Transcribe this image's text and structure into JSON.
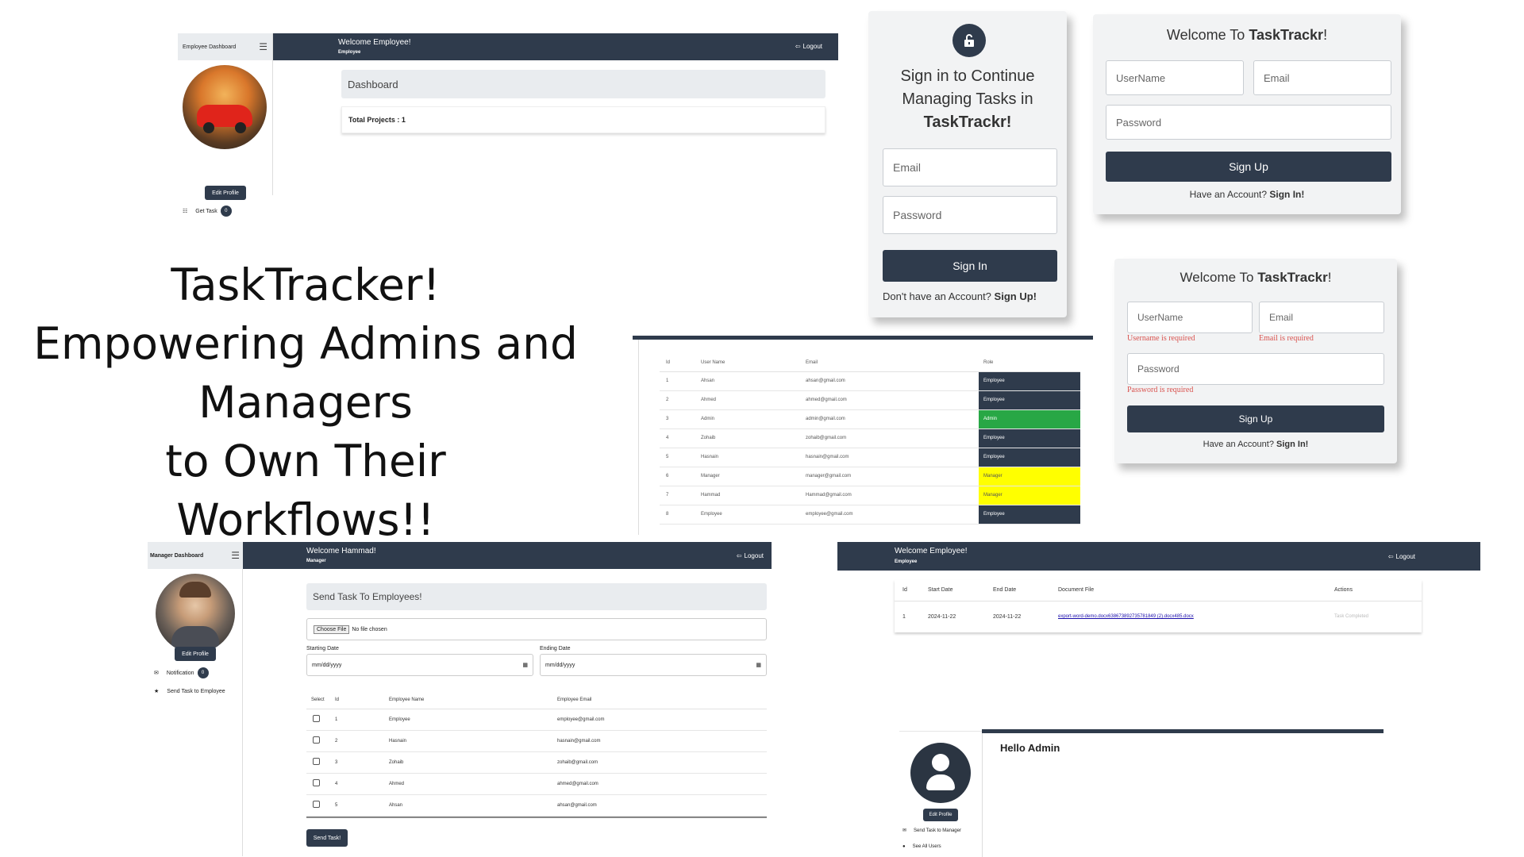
{
  "hero": {
    "line1": "TaskTracker!",
    "line2": "Empowering Admins and",
    "line3": "Managers",
    "line4": "to Own Their Workflows!!"
  },
  "employee_dashboard": {
    "sidebar_title": "Employee Dashboard",
    "welcome": "Welcome Employee!",
    "role": "Employee",
    "logout": "Logout",
    "edit_profile": "Edit Profile",
    "get_task": "Get Task",
    "task_count": "0",
    "dashboard_heading": "Dashboard",
    "total_projects": "Total Projects : 1"
  },
  "signin": {
    "line1": "Sign in to Continue",
    "line2": "Managing Tasks in",
    "brand": "TaskTrackr!",
    "email_placeholder": "Email",
    "password_placeholder": "Password",
    "button": "Sign In",
    "footer_text": "Don't have an Account?",
    "footer_link": "Sign Up!"
  },
  "signup1": {
    "welcome": "Welcome To",
    "brand": "TaskTrackr",
    "excl": "!",
    "username": "UserName",
    "email": "Email",
    "password": "Password",
    "button": "Sign Up",
    "footer_text": "Have an Account?",
    "footer_link": "Sign In!"
  },
  "signup2": {
    "welcome": "Welcome To",
    "brand": "TaskTrackr",
    "excl": "!",
    "username": "UserName",
    "email": "Email",
    "password": "Password",
    "username_error": "Username is required",
    "email_error": "Email is required",
    "password_error": "Password is required",
    "button": "Sign Up",
    "footer_text": "Have an Account?",
    "footer_link": "Sign In!"
  },
  "users_table": {
    "headers": [
      "Id",
      "User Name",
      "Email",
      "Role"
    ],
    "rows": [
      {
        "id": "1",
        "name": "Ahsan",
        "email": "ahsan@gmail.com",
        "role": "Employee",
        "color": "#2f3b4c"
      },
      {
        "id": "2",
        "name": "Ahmed",
        "email": "ahmed@gmail.com",
        "role": "Employee",
        "color": "#2f3b4c"
      },
      {
        "id": "3",
        "name": "Admin",
        "email": "admin@gmail.com",
        "role": "Admin",
        "color": "#28a745"
      },
      {
        "id": "4",
        "name": "Zohaib",
        "email": "zohaib@gmail.com",
        "role": "Employee",
        "color": "#2f3b4c"
      },
      {
        "id": "5",
        "name": "Hasnain",
        "email": "hasnain@gmail.com",
        "role": "Employee",
        "color": "#2f3b4c"
      },
      {
        "id": "6",
        "name": "Manager",
        "email": "manager@gmail.com",
        "role": "Manager",
        "color": "#ffff00"
      },
      {
        "id": "7",
        "name": "Hammad",
        "email": "Hammad@gmail.com",
        "role": "Manager",
        "color": "#ffff00"
      },
      {
        "id": "8",
        "name": "Employee",
        "email": "employee@gmail.com",
        "role": "Employee",
        "color": "#2f3b4c"
      }
    ]
  },
  "manager_dashboard": {
    "sidebar_title": "Manager Dashboard",
    "welcome": "Welcome Hammad!",
    "role": "Manager",
    "logout": "Logout",
    "edit_profile": "Edit Profile",
    "notification": "Notification",
    "notification_count": "0",
    "send_task_employee": "Send Task to Employee",
    "heading": "Send Task To Employees!",
    "choose_file": "Choose File",
    "no_file": "No file chosen",
    "starting_date": "Starting Date",
    "ending_date": "Ending Date",
    "date_placeholder": "mm/dd/yyyy",
    "headers": [
      "Select",
      "Id",
      "Employee Name",
      "Employee Email"
    ],
    "rows": [
      {
        "id": "1",
        "name": "Employee",
        "email": "employee@gmail.com"
      },
      {
        "id": "2",
        "name": "Hasnain",
        "email": "hasnain@gmail.com"
      },
      {
        "id": "3",
        "name": "Zohaib",
        "email": "zohaib@gmail.com"
      },
      {
        "id": "4",
        "name": "Ahmed",
        "email": "ahmed@gmail.com"
      },
      {
        "id": "5",
        "name": "Ahsan",
        "email": "ahsan@gmail.com"
      }
    ],
    "send_button": "Send Task!"
  },
  "employee_tasks": {
    "welcome": "Welcome Employee!",
    "role": "Employee",
    "logout": "Logout",
    "headers": [
      "Id",
      "Start Date",
      "End Date",
      "Document File",
      "Actions"
    ],
    "rows": [
      {
        "id": "1",
        "start": "2024-11-22",
        "end": "2024-11-22",
        "file": "export-word-demo.docx638673892735781849 (2).docx485.docx",
        "action": "Task Completed"
      }
    ]
  },
  "admin_panel": {
    "hello": "Hello Admin",
    "edit_profile": "Edit Profile",
    "send_task_manager": "Send Task to Manager",
    "see_all_users": "See All Users"
  },
  "colors": {
    "navy": "#2f3b4c",
    "admin_green": "#28a745",
    "manager_yellow": "#ffff00",
    "error_red": "#d9534f",
    "link_blue": "#1a0dab"
  }
}
